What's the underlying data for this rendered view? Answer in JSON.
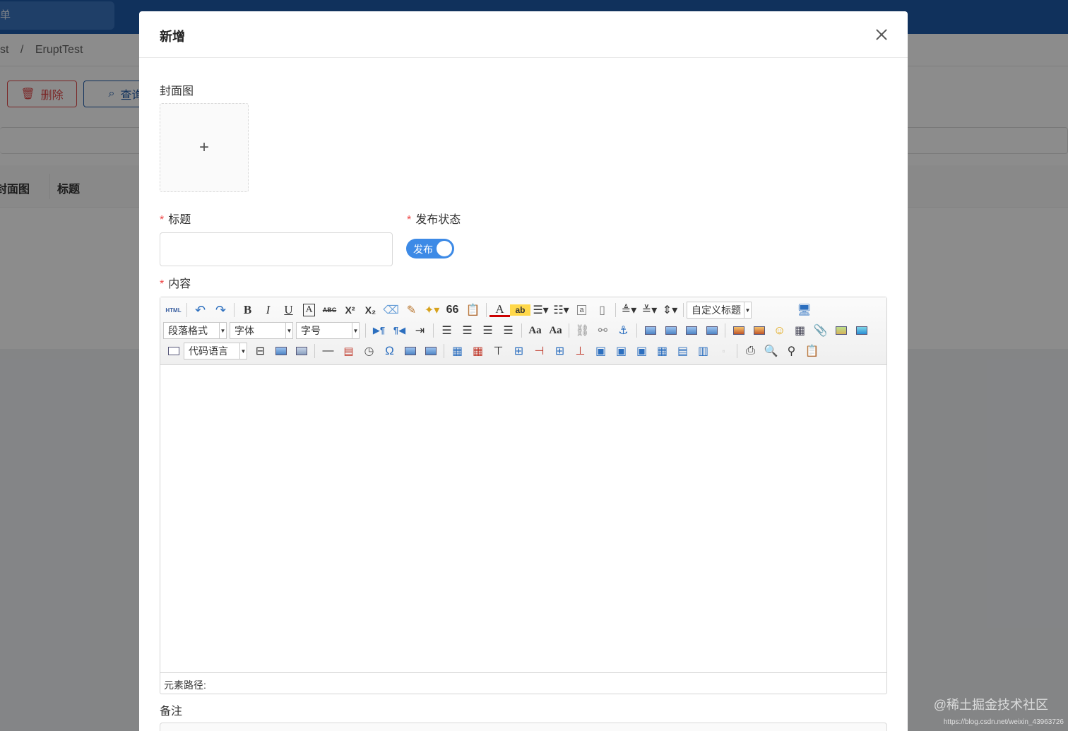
{
  "background": {
    "search_text": "单",
    "breadcrumb": [
      "st",
      "/",
      "EruptTest"
    ],
    "delete_button": "删除",
    "query_button": "查询",
    "table_headers": [
      "封面图",
      "标题"
    ]
  },
  "modal": {
    "title": "新增",
    "cover_label": "封面图",
    "upload_plus": "+",
    "title_label": "标题",
    "title_value": "",
    "status_label": "发布状态",
    "status_switch_text": "发布",
    "status_on": true,
    "content_label": "内容",
    "remark_label": "备注",
    "required_mark": "*"
  },
  "editor": {
    "html_label": "HTML",
    "custom_title": "自定义标题",
    "paragraph": "段落格式",
    "font": "字体",
    "font_size": "字号",
    "code_lang": "代码语言",
    "element_path": "元素路径:",
    "icons": {
      "bold": "B",
      "italic": "I",
      "underline": "U",
      "font_border": "A",
      "strike": "ABC",
      "superscript": "X²",
      "subscript": "X₂",
      "blockquote": "66",
      "font_color": "A",
      "highlight": "ab",
      "special_char": "Ω",
      "insert_code": "a",
      "rtl": "¶◀",
      "ltr": "▶¶",
      "case_upper": "Aa",
      "case_lower": "Aa"
    }
  },
  "watermark": {
    "main": "@稀土掘金技术社区",
    "url": "https://blog.csdn.net/weixin_43963726"
  }
}
